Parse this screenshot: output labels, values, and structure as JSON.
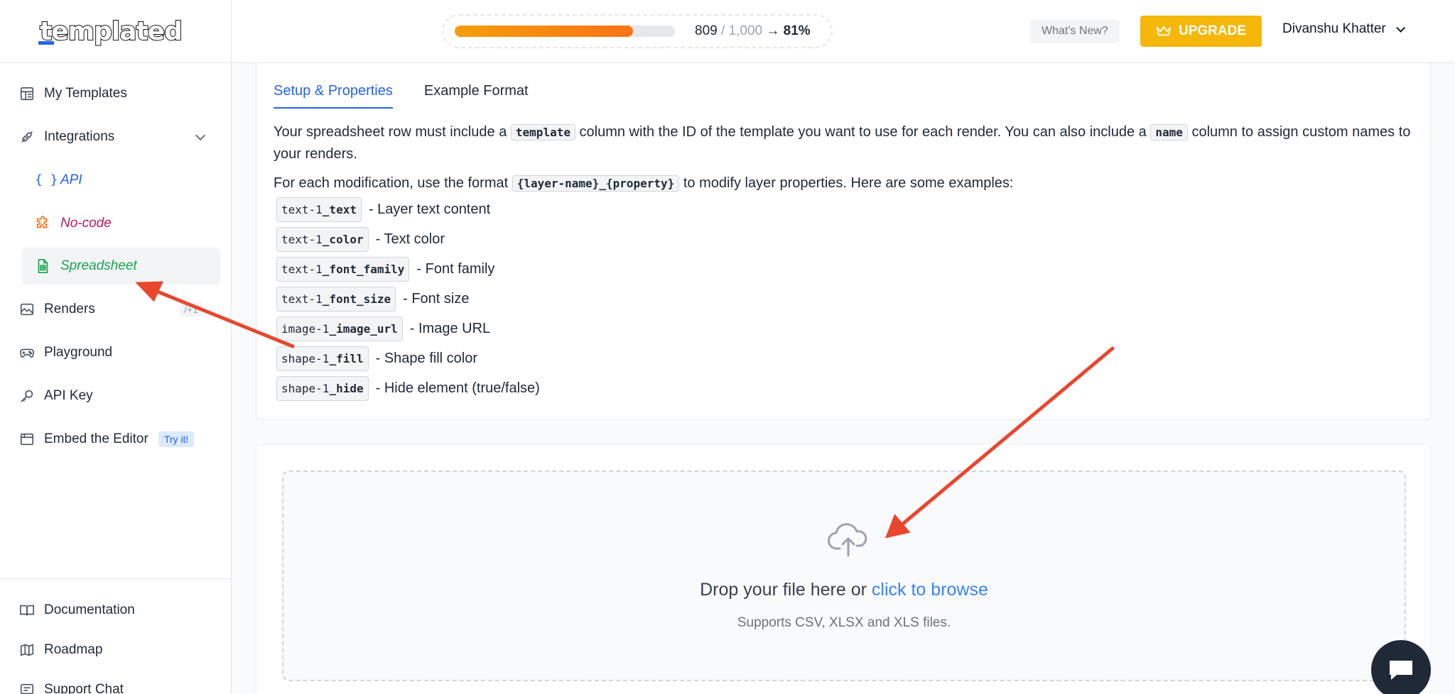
{
  "brand": {
    "logo_text": "templated"
  },
  "sidebar": {
    "items": [
      {
        "label": "My Templates",
        "icon": "layout-icon"
      },
      {
        "label": "Integrations",
        "icon": "plug-icon"
      },
      {
        "label": "API",
        "icon": "braces-icon"
      },
      {
        "label": "No-code",
        "icon": "puzzle-icon"
      },
      {
        "label": "Spreadsheet",
        "icon": "sheet-icon"
      },
      {
        "label": "Renders",
        "icon": "image-icon",
        "hint": "/+1"
      },
      {
        "label": "Playground",
        "icon": "gamepad-icon"
      },
      {
        "label": "API Key",
        "icon": "key-icon"
      },
      {
        "label": "Embed the Editor",
        "icon": "window-icon",
        "badge": "Try it!"
      }
    ],
    "bottom": [
      {
        "label": "Documentation",
        "icon": "book-icon"
      },
      {
        "label": "Roadmap",
        "icon": "map-icon"
      },
      {
        "label": "Support Chat",
        "icon": "chat-icon"
      }
    ]
  },
  "header": {
    "usage_used": "809",
    "usage_total": " / 1,000",
    "usage_arrow": "→",
    "usage_pct": "81%",
    "usage_fraction": 0.81,
    "whats_new": "What's New?",
    "upgrade": "UPGRADE",
    "user_name": "Divanshu Khatter"
  },
  "tabs": [
    "Setup & Properties",
    "Example Format"
  ],
  "instructions": {
    "p1_a": "Your spreadsheet row must include a ",
    "p1_code1": "template",
    "p1_b": " column with the ID of the template you want to use for each render. You can also include a ",
    "p1_code2": "name",
    "p1_c": " column to assign custom names to your renders.",
    "p2_a": "For each modification, use the format ",
    "p2_code": "{layer-name}_{property}",
    "p2_b": " to modify layer properties. Here are some examples:"
  },
  "examples": [
    {
      "prefix": "text-1",
      "prop": "_text",
      "desc": "- Layer text content"
    },
    {
      "prefix": "text-1",
      "prop": "_color",
      "desc": "- Text color"
    },
    {
      "prefix": "text-1",
      "prop": "_font_family",
      "desc": "- Font family"
    },
    {
      "prefix": "text-1",
      "prop": "_font_size",
      "desc": "- Font size"
    },
    {
      "prefix": "image-1",
      "prop": "_image_url",
      "desc": "- Image URL"
    },
    {
      "prefix": "shape-1",
      "prop": "_fill",
      "desc": "- Shape fill color"
    },
    {
      "prefix": "shape-1",
      "prop": "_hide",
      "desc": "- Hide element (true/false)"
    }
  ],
  "upload": {
    "title": "Drop your file here or ",
    "link": "click to browse",
    "subtitle": "Supports CSV, XLSX and XLS files."
  },
  "colors": {
    "accent": "#2563eb",
    "upgrade": "#f5b70a",
    "annotation_arrow": "#e8472e",
    "spreadsheet": "#16a34a",
    "nocode": "#be185d"
  }
}
